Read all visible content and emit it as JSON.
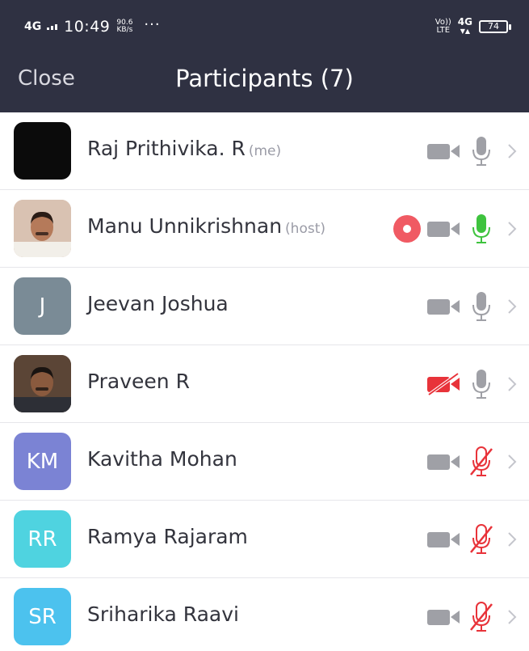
{
  "status_bar": {
    "network_left": "4G",
    "time": "10:49",
    "speed_value": "90.6",
    "speed_unit": "KB/s",
    "more": "···",
    "volte": "Vo) LTE",
    "volte_top": "Vo))",
    "volte_bottom": "LTE",
    "network_right": "4G",
    "battery_percent": "74"
  },
  "header": {
    "close_label": "Close",
    "title": "Participants (7)"
  },
  "colors": {
    "header_bg": "#2f3142",
    "muted_icon": "#9fa0a6",
    "mic_active": "#3ec33e",
    "muted_red": "#e8333a",
    "record_red": "#f05a63"
  },
  "participants": [
    {
      "name": "Raj Prithivika. R",
      "role": "(me)",
      "avatar_initials": "",
      "avatar_bg": "#0b0b0b",
      "avatar_icon": "black-photo",
      "recording": false,
      "video": "off",
      "mic": "on"
    },
    {
      "name": "Manu Unnikrishnan",
      "role": "(host)",
      "avatar_initials": "",
      "avatar_bg": "#c9a38a",
      "avatar_icon": "photo-man",
      "recording": true,
      "video": "off",
      "mic": "speaking"
    },
    {
      "name": "Jeevan Joshua",
      "role": "",
      "avatar_initials": "J",
      "avatar_bg": "#7a8b96",
      "recording": false,
      "video": "off",
      "mic": "on"
    },
    {
      "name": "Praveen R",
      "role": "",
      "avatar_initials": "",
      "avatar_bg": "#4a3a30",
      "avatar_icon": "photo-man-dark",
      "recording": false,
      "video": "muted",
      "mic": "on"
    },
    {
      "name": "Kavitha Mohan",
      "role": "",
      "avatar_initials": "KM",
      "avatar_bg": "#7b83d4",
      "recording": false,
      "video": "off",
      "mic": "muted"
    },
    {
      "name": "Ramya Rajaram",
      "role": "",
      "avatar_initials": "RR",
      "avatar_bg": "#4fd3e0",
      "recording": false,
      "video": "off",
      "mic": "muted"
    },
    {
      "name": "Sriharika Raavi",
      "role": "",
      "avatar_initials": "SR",
      "avatar_bg": "#4cc2ee",
      "recording": false,
      "video": "off",
      "mic": "muted"
    }
  ]
}
